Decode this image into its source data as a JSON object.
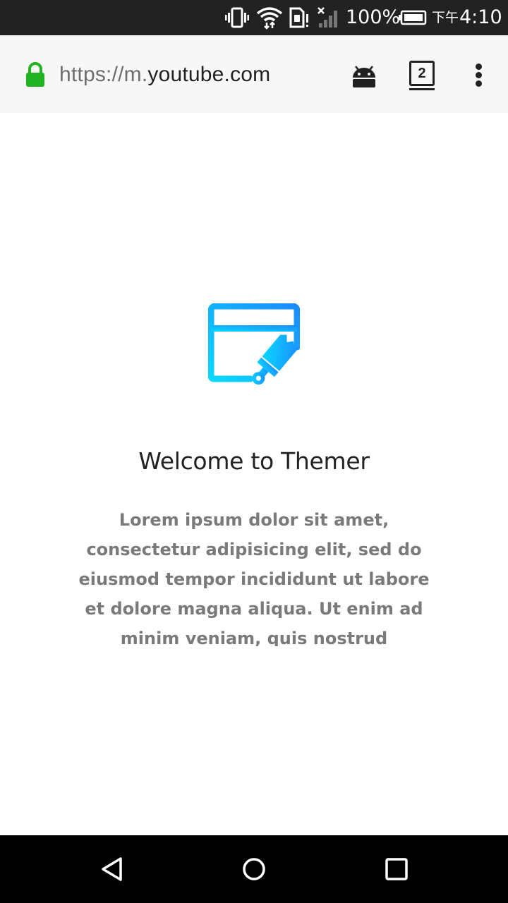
{
  "status_bar": {
    "battery_percent": "100%",
    "time_prefix": "下午",
    "time": "4:10",
    "icons": [
      "vibrate-icon",
      "wifi-icon",
      "sim-alert-icon",
      "signal-off-icon",
      "battery-icon"
    ]
  },
  "browser": {
    "url_scheme": "https://m.",
    "url_host": "youtube.com",
    "tab_count": "2",
    "colors": {
      "lock": "#22b322",
      "text": "#212121"
    }
  },
  "content": {
    "title": "Welcome to Themer",
    "body": "Lorem ipsum dolor sit amet, consectetur adipisicing elit, sed do eiusmod tempor incididunt ut labore et dolore magna aliqua. Ut enim ad minim veniam, quis nostrud exercitation",
    "logo_colors": [
      "#0ad8ff",
      "#1a8cff"
    ]
  },
  "nav_bar": {
    "buttons": [
      "back-icon",
      "home-icon",
      "recents-icon"
    ]
  }
}
